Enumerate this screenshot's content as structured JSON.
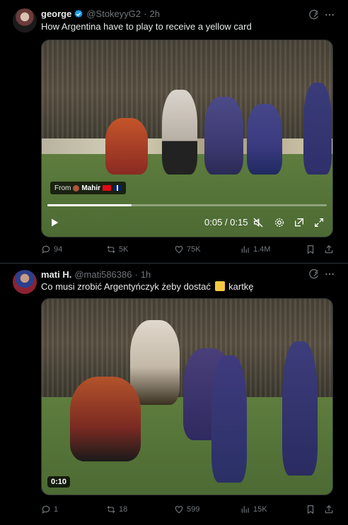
{
  "posts": [
    {
      "author_name": "george",
      "author_handle": "@StokeyyG2",
      "separator": "·",
      "time": "2h",
      "text": "How Argentina have to play to receive a yellow card",
      "video": {
        "from_label": "From",
        "from_name": "Mahir",
        "timecode": "0:05 / 0:15",
        "progress": 0.3
      },
      "replies": "94",
      "reposts": "5K",
      "likes": "75K",
      "views": "1.4M"
    },
    {
      "author_name": "mati H.",
      "author_handle": "@mati586386",
      "separator": "·",
      "time": "1h",
      "text_before": "Co musi zrobić Argentyńczyk żeby dostać",
      "text_after": "kartkę",
      "video": {
        "duration": "0:10"
      },
      "replies": "1",
      "reposts": "18",
      "likes": "599",
      "views": "15K"
    }
  ],
  "colors": {
    "background": "#000000",
    "text": "#e7e9ea",
    "muted": "#71767b",
    "verified": "#1d9bf0",
    "border": "#2f3336"
  }
}
